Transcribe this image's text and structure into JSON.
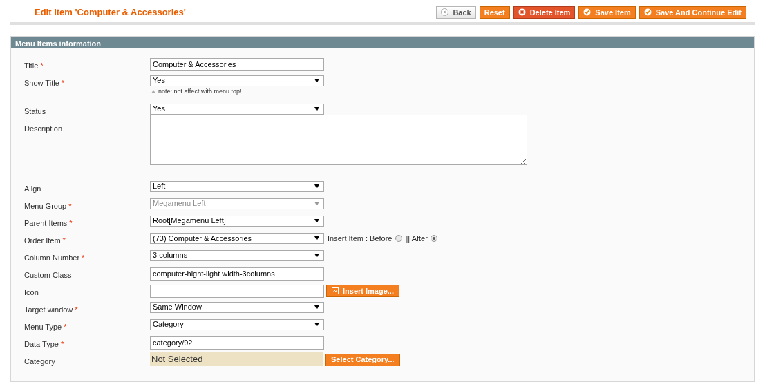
{
  "page_title": "Edit Item 'Computer & Accessories'",
  "buttons": [
    {
      "label": "Back",
      "kind": "back"
    },
    {
      "label": "Reset",
      "kind": "plain"
    },
    {
      "label": "Delete Item",
      "kind": "delete"
    },
    {
      "label": "Save Item",
      "kind": "save"
    },
    {
      "label": "Save And Continue Edit",
      "kind": "save"
    }
  ],
  "section_title": "Menu Items information",
  "fields": [
    {
      "label": "Title",
      "required_mark": "*",
      "kind": "text",
      "value": "Computer & Accessories"
    },
    {
      "label": "Show Title",
      "required_mark": "*",
      "kind": "select",
      "value": "Yes",
      "note": "note: not affect with menu top!"
    },
    {
      "label": "Status",
      "kind": "select",
      "value": "Yes"
    },
    {
      "label": "Description",
      "kind": "textarea"
    },
    {
      "label": "Align",
      "kind": "select",
      "value": "Left"
    },
    {
      "label": "Menu Group",
      "required_mark": "*",
      "kind": "select",
      "value": "Megamenu Left",
      "disabled": true
    },
    {
      "label": "Parent Items",
      "required_mark": "*",
      "kind": "select",
      "value": "Root[Megamenu Left]"
    },
    {
      "label": "Order Item",
      "required_mark": "*",
      "kind": "select",
      "value": "(73) Computer & Accessories",
      "insert_label": "Insert Item :",
      "options": [
        {
          "label": "Before",
          "selected": false
        },
        {
          "label": "|| After",
          "selected": true
        }
      ]
    },
    {
      "label": "Column Number",
      "required_mark": "*",
      "kind": "select",
      "value": "3 columns"
    },
    {
      "label": "Custom Class",
      "kind": "text",
      "value": "computer-hight-light width-3columns"
    },
    {
      "label": "Icon",
      "kind": "text",
      "button": "Insert Image..."
    },
    {
      "label": "Target window",
      "required_mark": "*",
      "kind": "select",
      "value": "Same Window"
    },
    {
      "label": "Menu Type",
      "required_mark": "*",
      "kind": "select",
      "value": "Category"
    },
    {
      "label": "Data Type",
      "required_mark": "*",
      "kind": "text",
      "value": "category/92"
    },
    {
      "label": "Category",
      "kind": "display",
      "value": "Not Selected",
      "button": "Select Category..."
    }
  ]
}
